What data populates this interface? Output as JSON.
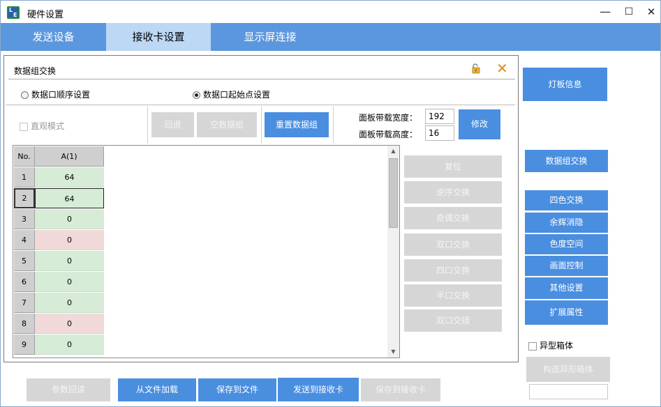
{
  "window": {
    "title": "硬件设置",
    "minimize": "—",
    "maximize": "☐",
    "close": "✕"
  },
  "tabs": [
    {
      "label": "发送设备"
    },
    {
      "label": "接收卡设置"
    },
    {
      "label": "显示屏连接"
    }
  ],
  "panel": {
    "title": "数据组交换",
    "radio_sequence": "数据口顺序设置",
    "radio_start": "数据口起始点设置",
    "intuitive_mode": "直观模式",
    "btn_back": "回退",
    "btn_empty_group": "空数据组",
    "btn_reset_group": "重置数据组",
    "width_label": "面板带载宽度：",
    "width_value": "192",
    "height_label": "面板带载高度：",
    "height_value": "16",
    "btn_modify": "修改",
    "grid": {
      "col_no": "No.",
      "col_a": "A(1)",
      "rows": [
        {
          "no": "1",
          "value": "64"
        },
        {
          "no": "2",
          "value": "64"
        },
        {
          "no": "3",
          "value": "0"
        },
        {
          "no": "4",
          "value": "0"
        },
        {
          "no": "5",
          "value": "0"
        },
        {
          "no": "6",
          "value": "0"
        },
        {
          "no": "7",
          "value": "0"
        },
        {
          "no": "8",
          "value": "0"
        },
        {
          "no": "9",
          "value": "0"
        }
      ]
    },
    "actions": {
      "reset": "复位",
      "reverse": "逆序交换",
      "odd_even": "奇偶交换",
      "dual_port": "双口交换",
      "quad_port": "四口交换",
      "half_port": "半口交换",
      "dual_offset": "双口交错"
    }
  },
  "sidebar": {
    "lamp_info": "灯板信息",
    "data_group_swap": "数据组交换",
    "four_color": "四色交换",
    "afterglow": "余辉消隐",
    "color_space": "色度空间",
    "picture_control": "画面控制",
    "other_settings": "其他设置",
    "extended": "扩展属性",
    "irregular_box": "异型箱体",
    "build_irregular": "构造异形箱体"
  },
  "bottom": {
    "readback": "参数回读",
    "load_file": "从文件加载",
    "save_file": "保存到文件",
    "send_card": "发送到接收卡",
    "save_card": "保存到接收卡"
  },
  "colors": {
    "accent": "#4a8ee0",
    "tabbar": "#5b97de",
    "tab_active": "#bcd8f5",
    "cell_green": "#d6ecd6",
    "cell_red": "#f1d9d9",
    "disabled": "#d6d6d6"
  }
}
